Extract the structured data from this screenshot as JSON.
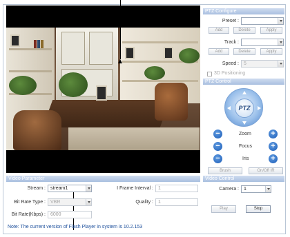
{
  "ptz_configure": {
    "header": "PTZ Configure",
    "preset_label": "Preset :",
    "preset_value": "",
    "track_label": "Track :",
    "track_value": "",
    "speed_label": "Speed :",
    "speed_value": "5",
    "add_label": "Add",
    "delete_label": "Delete",
    "apply_label": "Apply",
    "positioning_label": "3D Positioning"
  },
  "ptz_control": {
    "header": "PTZ Control",
    "wheel_label": "PTZ",
    "zoom_label": "Zoom",
    "focus_label": "Focus",
    "iris_label": "Iris",
    "brush_label": "Brush",
    "onoff_ir_label": "On/Off IR"
  },
  "video_parameter": {
    "header": "Video Parameter",
    "stream_label": "Stream :",
    "stream_value": "stream1",
    "bitrate_type_label": "Bit Rate Type :",
    "bitrate_type_value": "VBR",
    "bitrate_label": "Bit Rate(Kbps) :",
    "bitrate_value": "6000",
    "iframe_label": "I Frame Interval :",
    "iframe_value": "1",
    "quality_label": "Quality :",
    "quality_value": "1"
  },
  "video_control": {
    "header": "Video Control",
    "camera_label": "Camera :",
    "camera_value": "1",
    "play_label": "Play",
    "stop_label": "Stop"
  },
  "note": "Note: The current version of Flash Player in system is 10.2.153",
  "colors": {
    "panel_header": "#a9bfdf",
    "ptz_blue": "#1d5db8",
    "note_blue": "#1b4e9b"
  }
}
